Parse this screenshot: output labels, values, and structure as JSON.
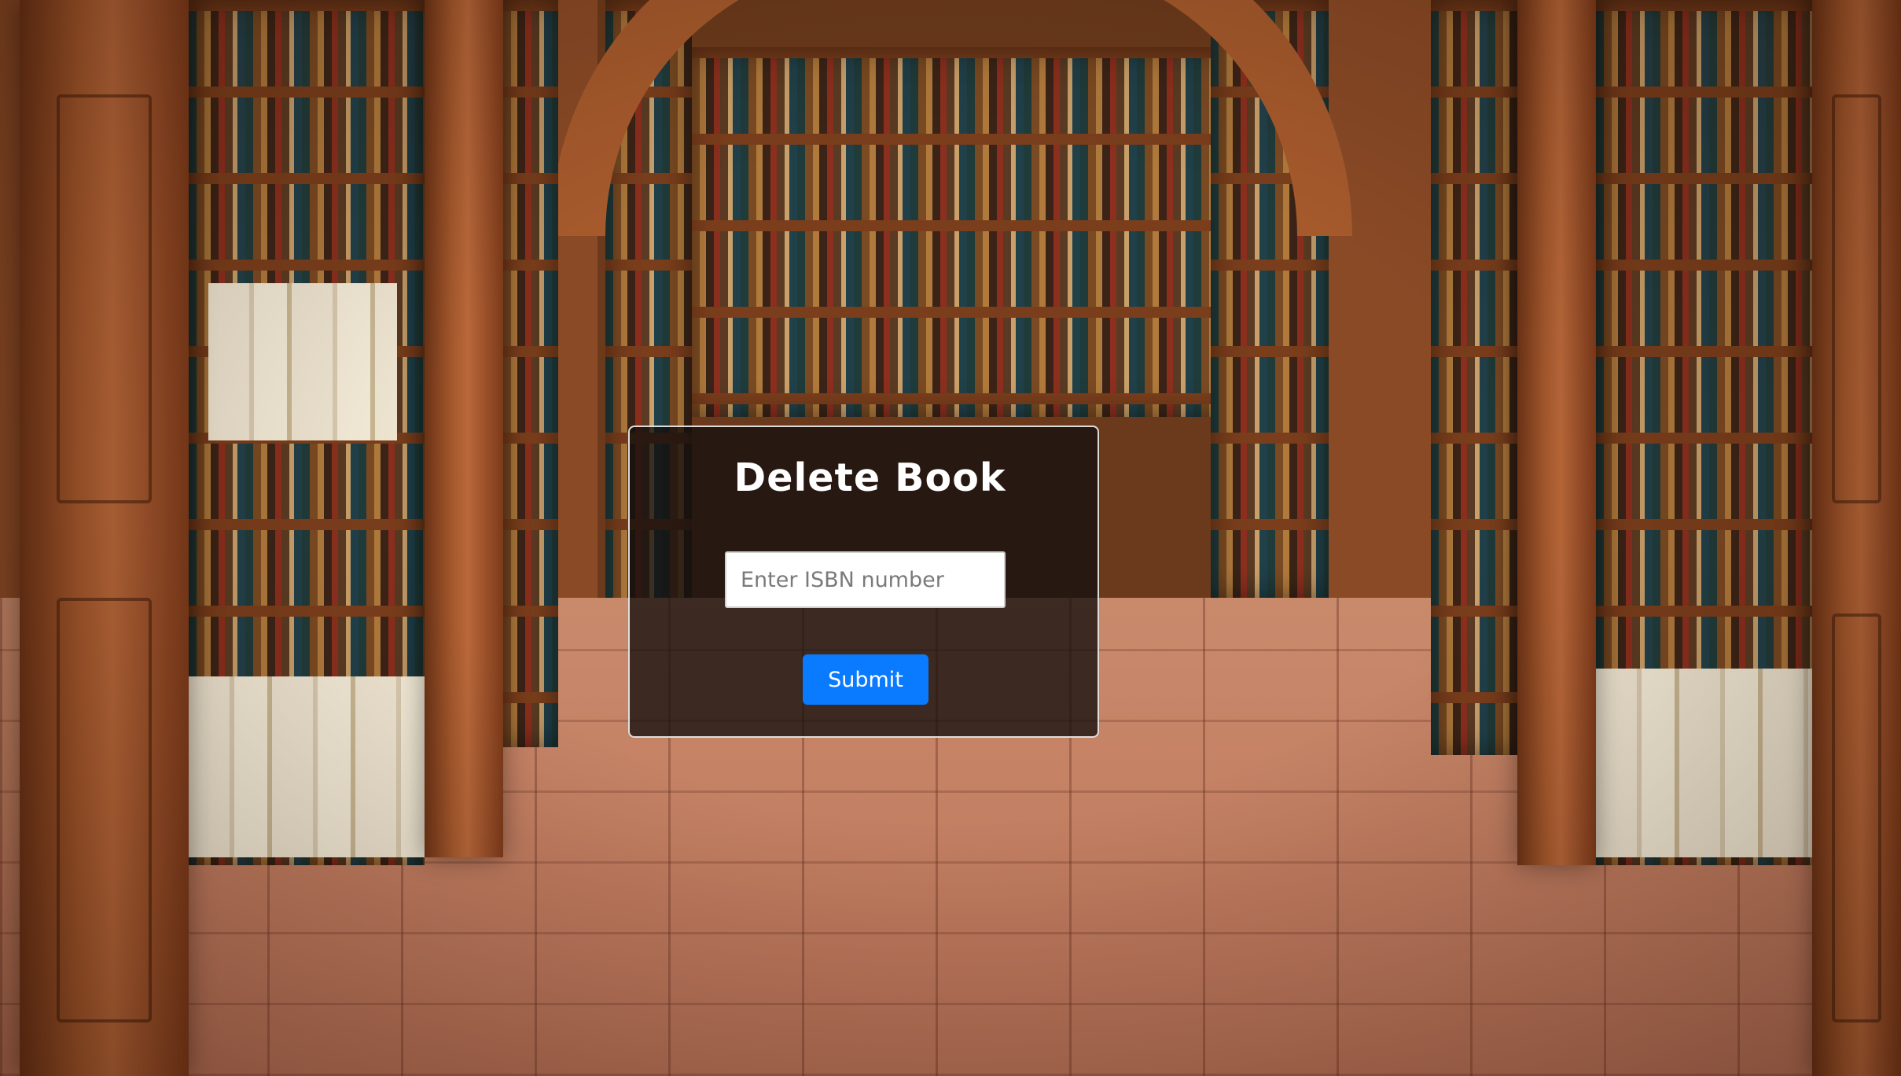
{
  "page": {
    "title": "Delete Book"
  },
  "form": {
    "isbn_placeholder": "Enter ISBN number",
    "isbn_value": "",
    "submit_label": "Submit"
  },
  "colors": {
    "submit_button": "#0a7bff",
    "modal_background": "rgba(20,16,14,0.78)",
    "title_text": "#ffffff"
  }
}
